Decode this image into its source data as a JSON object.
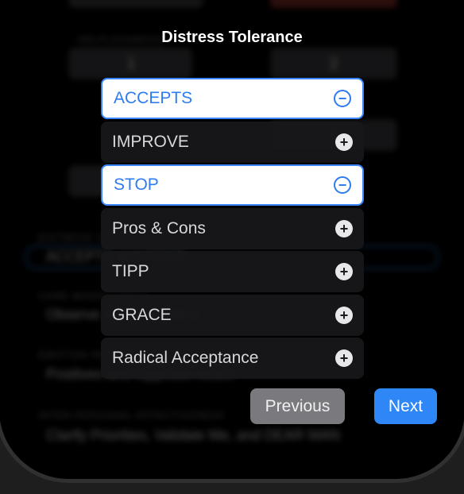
{
  "dialog": {
    "title": "Distress Tolerance"
  },
  "skills": [
    {
      "label": "ACCEPTS",
      "selected": true,
      "icon": "minus-circle-icon"
    },
    {
      "label": "IMPROVE",
      "selected": false,
      "icon": "plus-circle-icon"
    },
    {
      "label": "STOP",
      "selected": true,
      "icon": "minus-circle-icon"
    },
    {
      "label": "Pros & Cons",
      "selected": false,
      "icon": "plus-circle-icon"
    },
    {
      "label": "TIPP",
      "selected": false,
      "icon": "plus-circle-icon"
    },
    {
      "label": "GRACE",
      "selected": false,
      "icon": "plus-circle-icon"
    },
    {
      "label": "Radical Acceptance",
      "selected": false,
      "icon": "plus-circle-icon"
    }
  ],
  "buttons": {
    "previous": "Previous",
    "next": "Next"
  },
  "background": {
    "field_label_1": "HELPLESSNESS",
    "field_value_1": "1",
    "field_value_2": "2",
    "field_value_3": "1",
    "distress_label": "DISTRESS TOLERANCE",
    "distress_value": "ACCEPTS and STOP",
    "core_label": "CORE MINDFULNESS",
    "core_value": "Observe and Wise Mind",
    "emotion_label": "EMOTION REGULATION",
    "emotion_value": "Positives and Opposite Action",
    "interpersonal_label": "INTER-PERSONAL EFFECTIVENESS",
    "interpersonal_value": "Clarify Priorities, Validate Me, and DEAR MAN"
  },
  "colors": {
    "accent": "#2f86f6",
    "selected_text": "#2f7bf0"
  }
}
